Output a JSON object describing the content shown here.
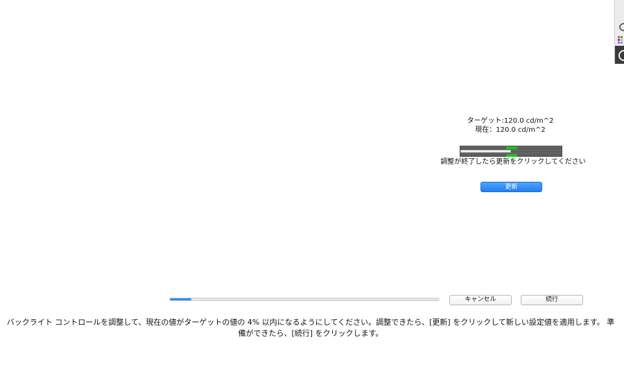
{
  "calibration": {
    "target_text": "ターゲット:120.0 cd/m^2",
    "current_text": "現在：120.0 cd/m^2",
    "meter_level": 0.5,
    "instruction": "調整が終了したら更新をクリックしてください",
    "update_label": "更新"
  },
  "footer": {
    "progress": 0.08,
    "cancel_label": "キャンセル",
    "continue_label": "続行",
    "message_line1": "バックライト コントロールを調整して、現在の値がターゲットの値の 4% 以内になるようにしてください。調整できたら、[更新] をクリックして新しい設定値を適用します。 準",
    "message_line2": "備ができたら、[続行] をクリックします。"
  },
  "colors": {
    "accent": "#2f8bf0",
    "meter_ok": "#1ec21e"
  },
  "edge_panel": {
    "icons": [
      "eye-icon",
      "grid-icon",
      "info-icon"
    ]
  }
}
